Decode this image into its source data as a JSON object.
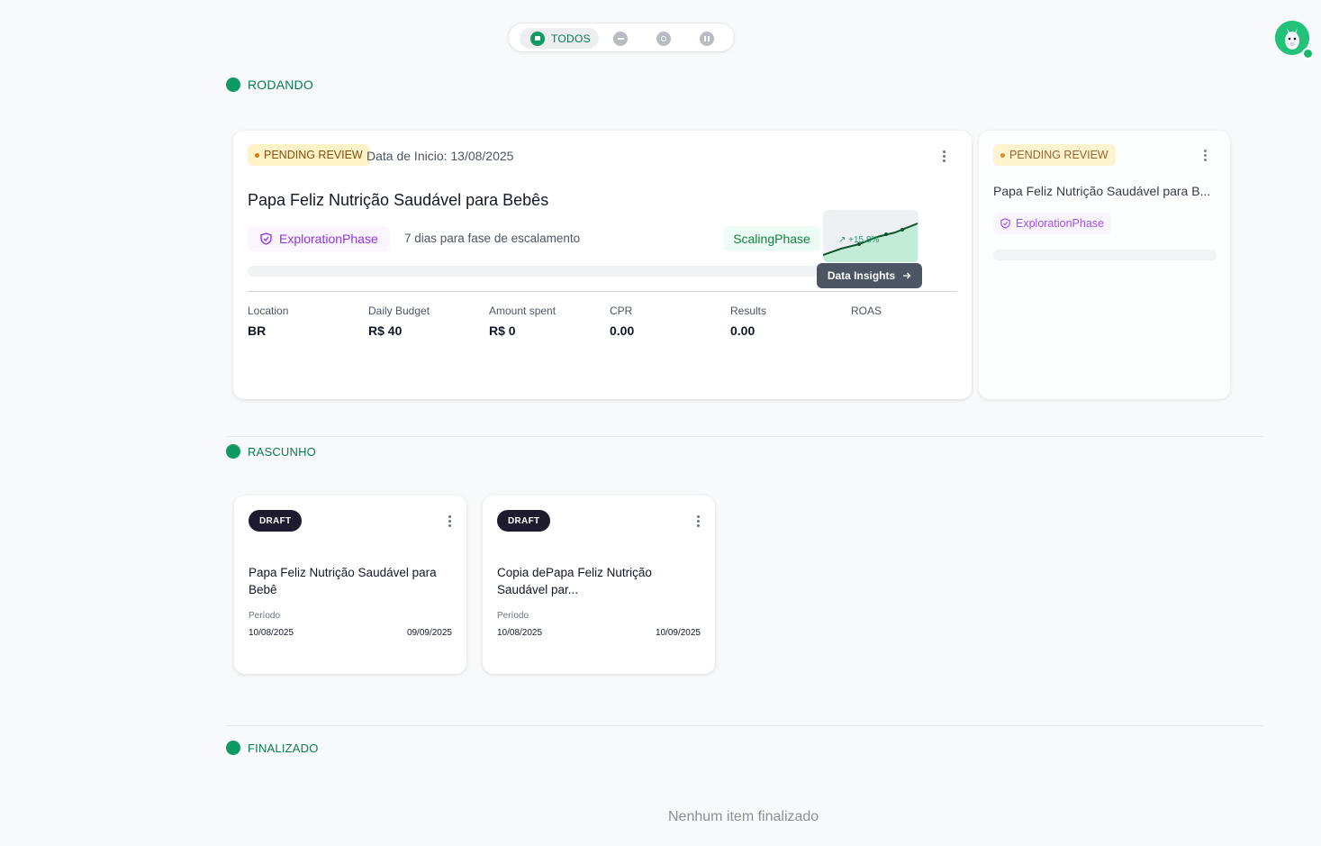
{
  "filter": {
    "active_label": "TODOS",
    "icons": [
      "folder-icon",
      "minus-circle-icon",
      "refresh-icon",
      "pause-icon"
    ]
  },
  "sections": {
    "running": "RODANDO",
    "draft": "RASCUNHO",
    "finished": "FINALIZADO"
  },
  "running_cards": [
    {
      "status": "PENDING REVIEW",
      "start_date": "Data de Inicio: 13/08/2025",
      "title": "Papa Feliz Nutrição Saudável para Bebês",
      "phase": "ExplorationPhase",
      "phase_note": "7 dias para fase de escalamento",
      "next_phase": "ScalingPhase",
      "chart_change": "↗ +15.8%",
      "insights_label": "Data Insights",
      "metrics": [
        {
          "label": "Location",
          "value": "BR"
        },
        {
          "label": "Daily Budget",
          "value": "R$ 40"
        },
        {
          "label": "Amount spent",
          "value": "R$ 0"
        },
        {
          "label": "CPR",
          "value": "0.00"
        },
        {
          "label": "Results",
          "value": "0.00"
        },
        {
          "label": "ROAS",
          "value": ""
        }
      ]
    },
    {
      "status": "PENDING REVIEW",
      "title": "Papa Feliz Nutrição Saudável para B...",
      "phase": "ExplorationPhase"
    }
  ],
  "draft_cards": [
    {
      "badge": "DRAFT",
      "title": "Papa Feliz Nutrição Saudável para Bebê",
      "period_label": "Período",
      "start": "10/08/2025",
      "end": "09/09/2025"
    },
    {
      "badge": "DRAFT",
      "title": "Copia dePapa Feliz Nutrição Saudável par...",
      "period_label": "Período",
      "start": "10/08/2025",
      "end": "10/09/2025"
    }
  ],
  "finished": {
    "empty_text": "Nenhum item finalizado"
  },
  "colors": {
    "accent": "#0f9a63",
    "pending_bg": "#fef3c7",
    "phase_purple": "#9333ea",
    "draft_badge": "#1e1b2e"
  }
}
